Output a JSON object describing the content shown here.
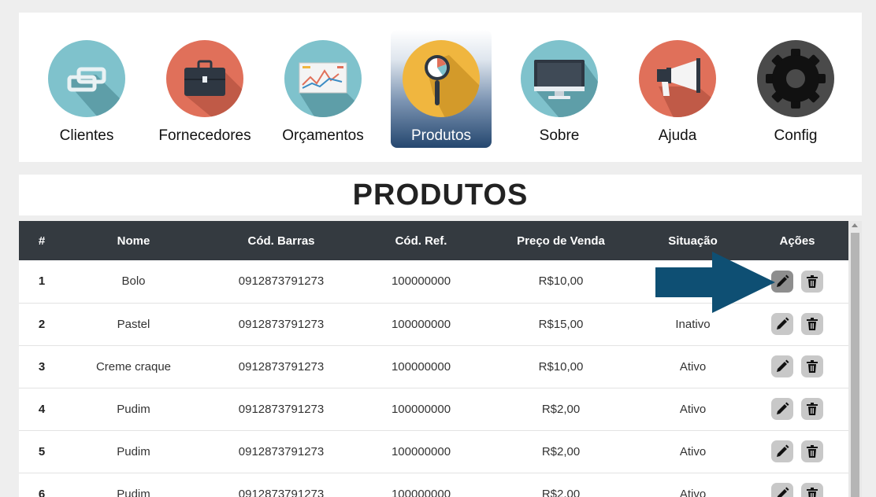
{
  "nav": {
    "items": [
      {
        "label": "Clientes",
        "icon": "link-icon"
      },
      {
        "label": "Fornecedores",
        "icon": "briefcase-icon"
      },
      {
        "label": "Orçamentos",
        "icon": "chart-board-icon"
      },
      {
        "label": "Produtos",
        "icon": "magnifier-icon",
        "active": true
      },
      {
        "label": "Sobre",
        "icon": "monitor-icon"
      },
      {
        "label": "Ajuda",
        "icon": "megaphone-icon"
      },
      {
        "label": "Config",
        "icon": "gear-icon"
      }
    ]
  },
  "page_title": "PRODUTOS",
  "table": {
    "headers": [
      "#",
      "Nome",
      "Cód. Barras",
      "Cód. Ref.",
      "Preço de Venda",
      "Situação",
      "Ações"
    ],
    "rows": [
      {
        "id": "1",
        "nome": "Bolo",
        "barras": "0912873791273",
        "ref": "100000000",
        "preco": "R$10,00",
        "situacao": ""
      },
      {
        "id": "2",
        "nome": "Pastel",
        "barras": "0912873791273",
        "ref": "100000000",
        "preco": "R$15,00",
        "situacao": "Inativo"
      },
      {
        "id": "3",
        "nome": "Creme craque",
        "barras": "0912873791273",
        "ref": "100000000",
        "preco": "R$10,00",
        "situacao": "Ativo"
      },
      {
        "id": "4",
        "nome": "Pudim",
        "barras": "0912873791273",
        "ref": "100000000",
        "preco": "R$2,00",
        "situacao": "Ativo"
      },
      {
        "id": "5",
        "nome": "Pudim",
        "barras": "0912873791273",
        "ref": "100000000",
        "preco": "R$2,00",
        "situacao": "Ativo"
      },
      {
        "id": "6",
        "nome": "Pudim",
        "barras": "0912873791273",
        "ref": "100000000",
        "preco": "R$2,00",
        "situacao": "Ativo"
      }
    ]
  },
  "colors": {
    "header_bg": "#343a40",
    "active_nav": "#25476f",
    "arrow": "#0e4f73"
  }
}
